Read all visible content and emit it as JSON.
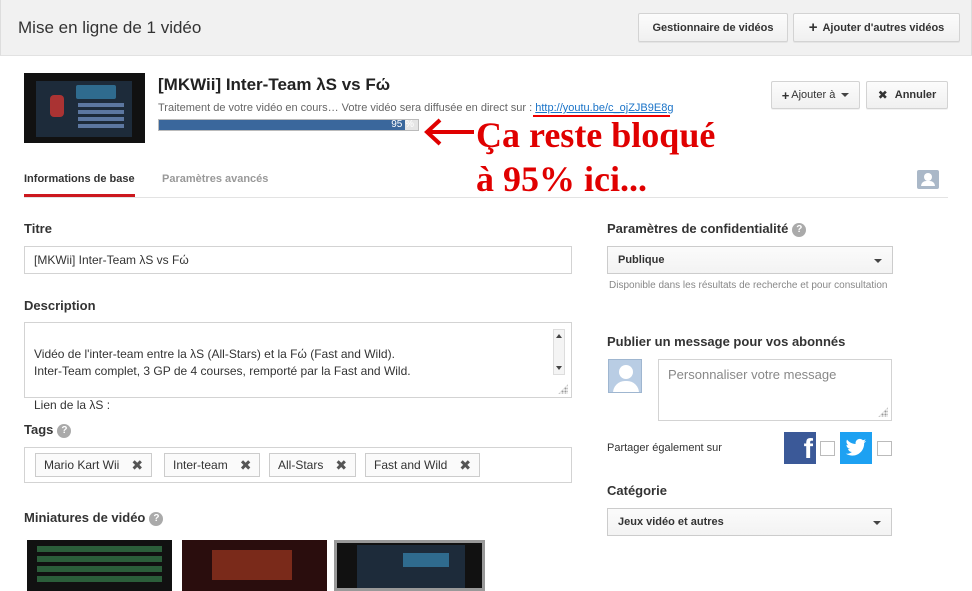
{
  "header": {
    "title": "Mise en ligne de 1 vidéo",
    "manager_label": "Gestionnaire de vidéos",
    "add_more_label": "Ajouter d'autres vidéos"
  },
  "video": {
    "title": "[MKWii] Inter-Team λS vs Fώ",
    "status_text": "Traitement de votre vidéo en cours… Votre vidéo sera diffusée en direct sur : ",
    "link": "http://youtu.be/c_ojZJB9E8g",
    "progress": 0.95,
    "progress_label": "95 %",
    "add_to_label": "Ajouter à",
    "cancel_label": "Annuler"
  },
  "annotation": {
    "line1": "Ça reste bloqué",
    "line2": "à 95% ici...",
    "color": "#e00000"
  },
  "tabs": [
    {
      "label": "Informations de base",
      "active": true
    },
    {
      "label": "Paramètres avancés",
      "active": false
    }
  ],
  "form": {
    "title_label": "Titre",
    "title_value": "[MKWii] Inter-Team λS vs Fώ",
    "description_label": "Description",
    "description_value": "Vidéo de l'inter-team entre la λS (All-Stars) et la Fώ (Fast and Wild).\nInter-Team complet, 3 GP de 4 courses, remporté par la Fast and Wild.\n\nLien de la λS :",
    "tags_label": "Tags",
    "tags": [
      "Mario Kart Wii",
      "Inter-team",
      "All-Stars",
      "Fast and Wild"
    ],
    "thumbnails_label": "Miniatures de vidéo"
  },
  "right": {
    "privacy_label": "Paramètres de confidentialité",
    "privacy_value": "Publique",
    "privacy_hint": "Disponible dans les résultats de recherche et pour consultation",
    "message_label": "Publier un message pour vos abonnés",
    "message_placeholder": "Personnaliser votre message",
    "share_label": "Partager également sur",
    "category_label": "Catégorie",
    "category_value": "Jeux vidéo et autres"
  },
  "icons": {
    "help": "?",
    "remove": "✖",
    "facebook": "f"
  },
  "colors": {
    "progress_fill": "#3a679c",
    "tab_active": "#cc181e",
    "link": "#1a73c8",
    "facebook": "#3b5998",
    "twitter": "#1da1f2"
  }
}
